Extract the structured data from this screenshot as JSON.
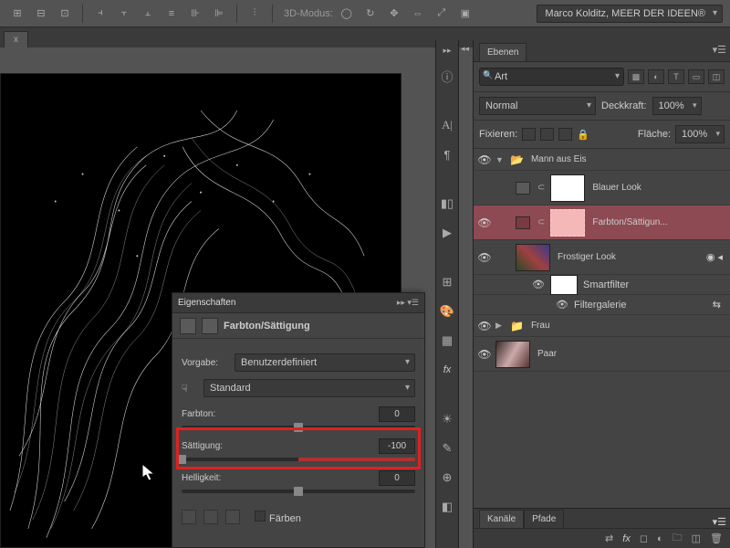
{
  "topbar": {
    "mode3d_label": "3D-Modus:",
    "workspace": "Marco Kolditz, MEER DER IDEEN®"
  },
  "document": {
    "tab_close": "x"
  },
  "properties": {
    "panel_title": "Eigenschaften",
    "subtitle": "Farbton/Sättigung",
    "preset_label": "Vorgabe:",
    "preset_value": "Benutzerdefiniert",
    "channel_value": "Standard",
    "hue_label": "Farbton:",
    "hue_value": "0",
    "sat_label": "Sättigung:",
    "sat_value": "-100",
    "light_label": "Helligkeit:",
    "light_value": "0",
    "colorize_label": "Färben"
  },
  "layers_panel": {
    "tab": "Ebenen",
    "search_label": "Art",
    "blend_mode": "Normal",
    "opacity_label": "Deckkraft:",
    "opacity_value": "100%",
    "lock_label": "Fixieren:",
    "fill_label": "Fläche:",
    "fill_value": "100%",
    "group1": "Mann aus Eis",
    "layer_blue": "Blauer Look",
    "layer_hs": "Farbton/Sättigun...",
    "layer_frost": "Frostiger Look",
    "smartfilter": "Smartfilter",
    "filtergallery": "Filtergalerie",
    "group2": "Frau",
    "layer_paar": "Paar"
  },
  "channels": {
    "tab1": "Kanäle",
    "tab2": "Pfade"
  }
}
